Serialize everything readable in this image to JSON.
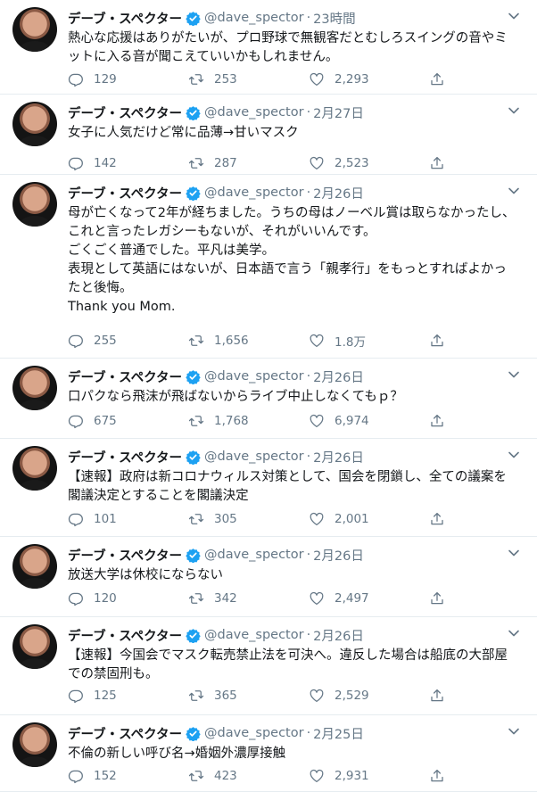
{
  "colors": {
    "verified": "#1da1f2",
    "secondary": "#657786",
    "border": "#e6ecf0"
  },
  "icons": {
    "reply": "reply-icon",
    "retweet": "retweet-icon",
    "like": "like-icon",
    "share": "share-icon",
    "more": "chevron-down-icon",
    "verified": "verified-badge-icon"
  },
  "tweets": [
    {
      "name": "デーブ・スペクター",
      "handle": "@dave_spector",
      "separator": "·",
      "time": "23時間",
      "text": "熱心な応援はありがたいが、プロ野球で無観客だとむしろスイングの音やミットに入る音が聞こえていいかもしれません。",
      "replies": "129",
      "retweets": "253",
      "likes": "2,293"
    },
    {
      "name": "デーブ・スペクター",
      "handle": "@dave_spector",
      "separator": "·",
      "time": "2月27日",
      "text": "女子に人気だけど常に品薄→甘いマスク",
      "replies": "142",
      "retweets": "287",
      "likes": "2,523"
    },
    {
      "name": "デーブ・スペクター",
      "handle": "@dave_spector",
      "separator": "·",
      "time": "2月26日",
      "text": "母が亡くなって2年が経ちました。うちの母はノーベル賞は取らなかったし、\nこれと言ったレガシーもないが、それがいいんです。\nごくごく普通でした。平凡は美学。\n表現として英語にはないが、日本語で言う「親孝行」をもっとすればよかったと後悔。\nThank you Mom.",
      "replies": "255",
      "retweets": "1,656",
      "likes": "1.8万"
    },
    {
      "name": "デーブ・スペクター",
      "handle": "@dave_spector",
      "separator": "·",
      "time": "2月26日",
      "text": "口パクなら飛沫が飛ばないからライブ中止しなくてもｐ？",
      "replies": "675",
      "retweets": "1,768",
      "likes": "6,974"
    },
    {
      "name": "デーブ・スペクター",
      "handle": "@dave_spector",
      "separator": "·",
      "time": "2月26日",
      "text": "【速報】政府は新コロナウィルス対策として、国会を閉鎖し、全ての議案を閣議決定とすることを閣議決定",
      "replies": "101",
      "retweets": "305",
      "likes": "2,001"
    },
    {
      "name": "デーブ・スペクター",
      "handle": "@dave_spector",
      "separator": "·",
      "time": "2月26日",
      "text": "放送大学は休校にならない",
      "replies": "120",
      "retweets": "342",
      "likes": "2,497"
    },
    {
      "name": "デーブ・スペクター",
      "handle": "@dave_spector",
      "separator": "·",
      "time": "2月26日",
      "text": "【速報】今国会でマスク転売禁止法を可決へ。違反した場合は船底の大部屋での禁固刑も。",
      "replies": "125",
      "retweets": "365",
      "likes": "2,529"
    },
    {
      "name": "デーブ・スペクター",
      "handle": "@dave_spector",
      "separator": "·",
      "time": "2月25日",
      "text": "不倫の新しい呼び名→婚姻外濃厚接触",
      "replies": "152",
      "retweets": "423",
      "likes": "2,931"
    }
  ]
}
